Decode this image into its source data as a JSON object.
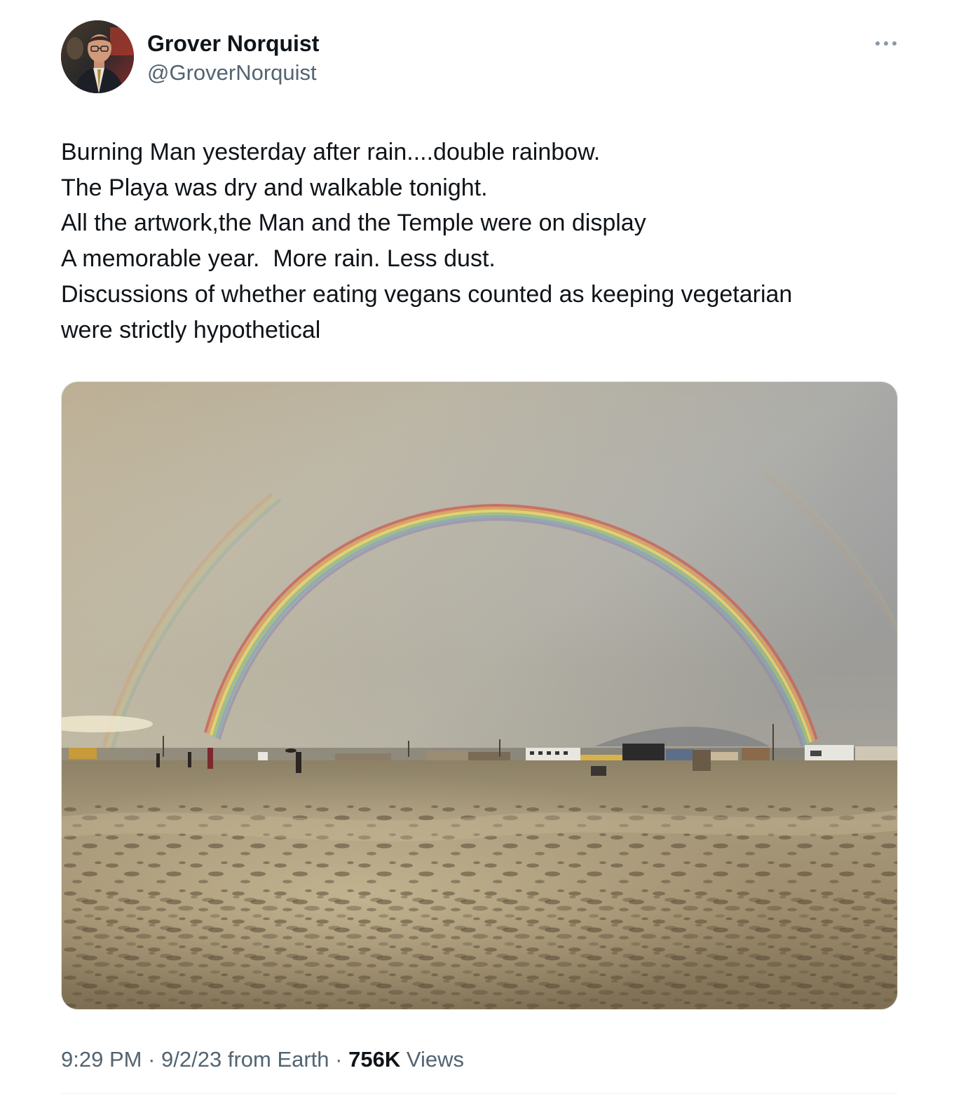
{
  "author": {
    "display_name": "Grover Norquist",
    "handle": "@GroverNorquist",
    "avatar_icon": "profile-photo"
  },
  "more_icon": "more-horizontal-icon",
  "tweet": {
    "lines": [
      "Burning Man yesterday after rain....double rainbow.",
      "The Playa was dry and walkable tonight.",
      "All the artwork,the Man and the Temple were on display",
      "A memorable year.  More rain. Less dust.",
      "Discussions of whether eating vegans counted as keeping vegetarian",
      "were strictly hypothetical"
    ]
  },
  "media": {
    "description_icon": "photo-double-rainbow"
  },
  "meta": {
    "time": "9:29 PM",
    "sep1": " · ",
    "date": "9/2/23",
    "source": " from Earth",
    "sep2": " · ",
    "views_count": "756K",
    "views_label": " Views"
  },
  "colors": {
    "text_primary": "#0f1419",
    "text_secondary": "#536471",
    "divider": "#eff3f4"
  }
}
